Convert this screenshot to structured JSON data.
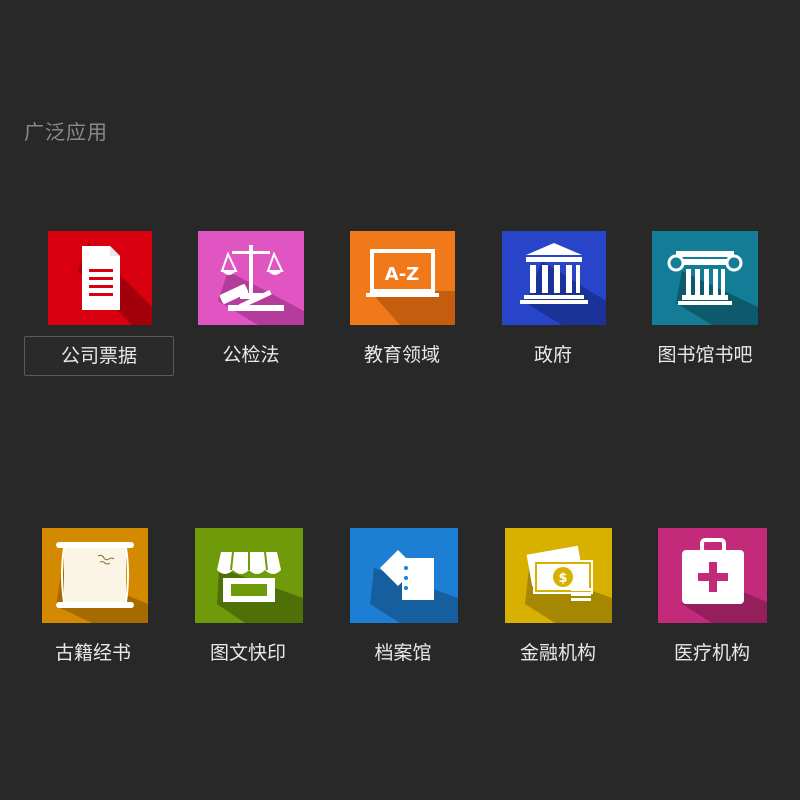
{
  "section": {
    "title": "广泛应用"
  },
  "apps": [
    {
      "label": "公司票据",
      "icon": "document-icon",
      "color": "#d8000f",
      "selected": true
    },
    {
      "label": "公检法",
      "icon": "scales-of-justice-icon",
      "color": "#e055c2",
      "selected": false
    },
    {
      "label": "教育领域",
      "icon": "chalkboard-az-icon",
      "color": "#f07a1a",
      "selected": false
    },
    {
      "label": "政府",
      "icon": "government-building-icon",
      "color": "#2845c9",
      "selected": false
    },
    {
      "label": "图书馆书吧",
      "icon": "ionic-column-icon",
      "color": "#137c96",
      "selected": false
    },
    {
      "label": "古籍经书",
      "icon": "scroll-icon",
      "color": "#d38a00",
      "selected": false
    },
    {
      "label": "图文快印",
      "icon": "storefront-icon",
      "color": "#6f9a0a",
      "selected": false
    },
    {
      "label": "档案馆",
      "icon": "folder-document-icon",
      "color": "#1c7fd4",
      "selected": false
    },
    {
      "label": "金融机构",
      "icon": "money-icon",
      "color": "#d8b100",
      "selected": false
    },
    {
      "label": "医疗机构",
      "icon": "medical-kit-icon",
      "color": "#c42a7a",
      "selected": false
    }
  ]
}
